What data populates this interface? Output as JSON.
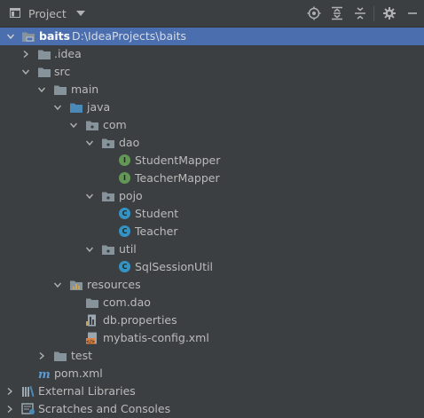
{
  "header": {
    "title": "Project",
    "buttons": [
      "locate-icon",
      "expand-all-icon",
      "collapse-all-icon",
      "gear-icon",
      "hide-icon"
    ]
  },
  "colors": {
    "selection": "#4b6eaf",
    "background": "#3c3f41",
    "interface_badge": "#629755",
    "class_badge": "#3592c4",
    "folder": "#87939a",
    "source_folder": "#4a8ab8",
    "resources_folder": "#c7a35a"
  },
  "tree": {
    "root_name": "baits",
    "root_path": "D:\\IdeaProjects\\baits",
    "idea": ".idea",
    "src": "src",
    "main": "main",
    "java": "java",
    "com": "com",
    "dao": "dao",
    "student_mapper": "StudentMapper",
    "teacher_mapper": "TeacherMapper",
    "pojo": "pojo",
    "student": "Student",
    "teacher": "Teacher",
    "util": "util",
    "sql_session_util": "SqlSessionUtil",
    "resources": "resources",
    "com_dao": "com.dao",
    "db_properties": "db.properties",
    "mybatis_config": "mybatis-config.xml",
    "test": "test",
    "pom": "pom.xml",
    "external_libraries": "External Libraries",
    "scratches": "Scratches and Consoles"
  }
}
